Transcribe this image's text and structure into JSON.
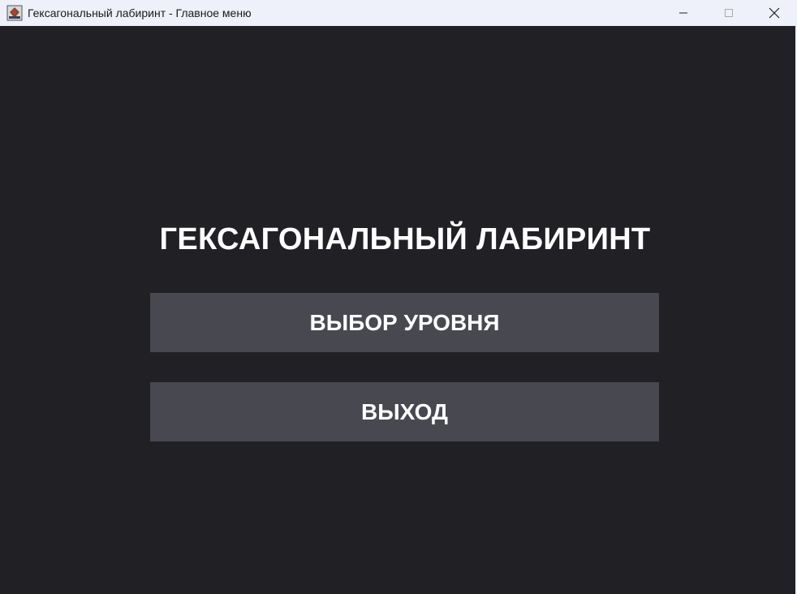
{
  "window": {
    "title": "Гексагональный лабиринт - Главное меню",
    "icon": "app-icon",
    "controls": [
      "minimize-icon",
      "maximize-icon",
      "close-icon"
    ]
  },
  "menu": {
    "title": "ГЕКСАГОНАЛЬНЫЙ ЛАБИРИНТ",
    "buttons": {
      "level_select": "ВЫБОР УРОВНЯ",
      "exit": "ВЫХОД"
    }
  },
  "colors": {
    "background": "#202025",
    "button": "#484851",
    "text": "#ffffff",
    "titlebar": "#eef1fa"
  }
}
